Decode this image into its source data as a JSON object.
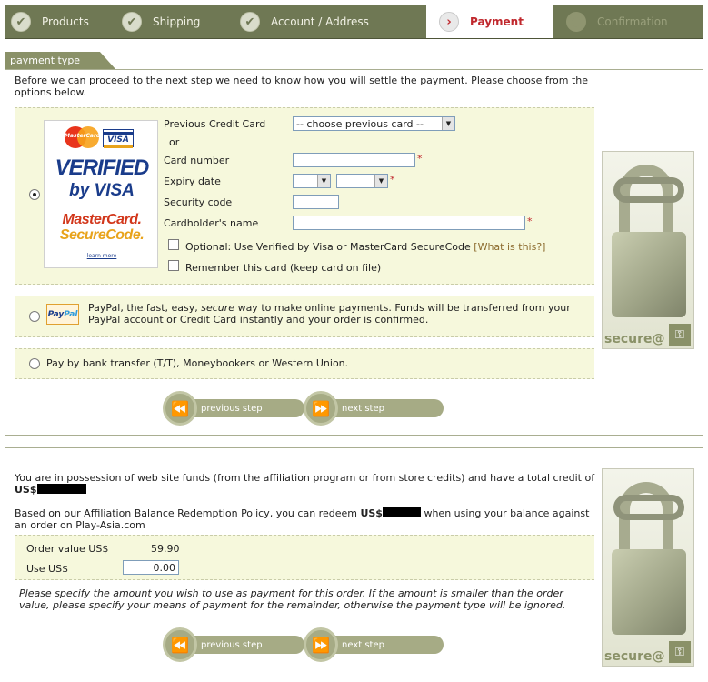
{
  "steps": [
    {
      "label": "Products",
      "state": "done"
    },
    {
      "label": "Shipping",
      "state": "done"
    },
    {
      "label": "Account / Address",
      "state": "done"
    },
    {
      "label": "Payment",
      "state": "active"
    },
    {
      "label": "Confirmation",
      "state": "pending"
    }
  ],
  "payment": {
    "tab_label": "payment type",
    "intro": "Before we can proceed to the next step we need to know how you will settle the payment. Please choose from the options below.",
    "card_logo": {
      "mastercard_small": "MasterCard",
      "visa_small": "VISA",
      "verified": "VERIFIED",
      "by_visa": "by VISA",
      "mc_name": "MasterCard.",
      "mc_secure": "SecureCode.",
      "learn_more": "learn more"
    },
    "credit_card": {
      "previous_label": "Previous Credit Card",
      "previous_select": "-- choose previous card --",
      "or_label": "or",
      "card_number_label": "Card number",
      "expiry_label": "Expiry date",
      "security_label": "Security code",
      "holder_label": "Cardholder's name",
      "required_mark": "*",
      "optional_label": "Optional: Use Verified by Visa or MasterCard SecureCode",
      "what_is_this": "[What is this?]",
      "remember_label": "Remember this card (keep card on file)"
    },
    "paypal": {
      "logo_a": "Pay",
      "logo_b": "Pal",
      "text_pre": "PayPal, the fast, easy, ",
      "text_em": "secure",
      "text_post": " way to make online payments. Funds will be transferred from your PayPal account or Credit Card instantly and your order is confirmed."
    },
    "bank_transfer": "Pay by bank transfer (T/T), Moneybookers or Western Union.",
    "prev_button": "previous step",
    "next_button": "next step",
    "secure_label": "secure@"
  },
  "funds": {
    "text1_pre": "You are in possession of web site funds (from the affiliation program or from store credits) and have a total credit of ",
    "currency": "US$",
    "text2_pre": "Based on our Affiliation Balance Redemption Policy, you can redeem ",
    "text2_post": " when using your balance against an order on Play-Asia.com",
    "order_value_label": "Order value US$",
    "order_value": "59.90",
    "use_label": "Use US$",
    "use_value": "0.00",
    "note": "Please specify the amount you wish to use as payment for this order. If the amount is smaller than the order value, please specify your means of payment for the remainder, otherwise the payment type will be ignored.",
    "prev_button": "previous step",
    "next_button": "next step",
    "secure_label": "secure@"
  },
  "icons": {
    "check": "✔",
    "arrow": "›",
    "dot": "●",
    "rewind": "⏪",
    "forward": "⏩",
    "dropdown": "▼",
    "key": "⚿"
  }
}
